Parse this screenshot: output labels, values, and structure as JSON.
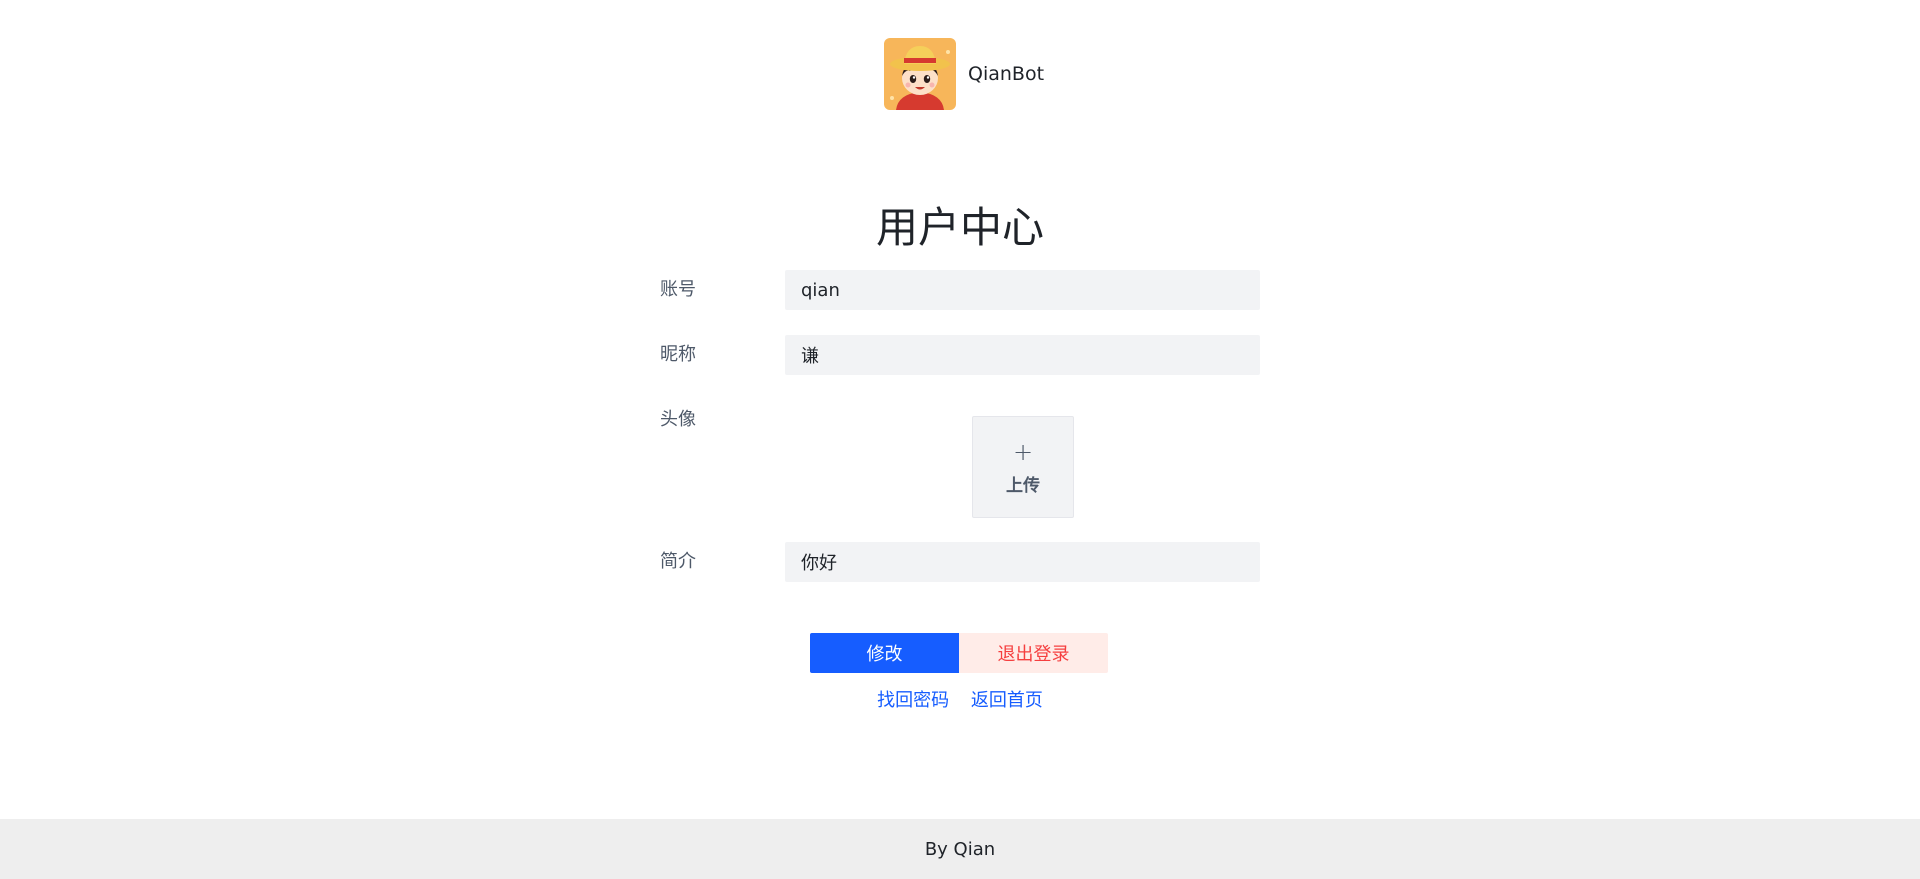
{
  "header": {
    "brand_name": "QianBot",
    "avatar_icon": "cartoon-boy-straw-hat-avatar"
  },
  "page": {
    "title": "用户中心"
  },
  "form": {
    "account": {
      "label": "账号",
      "value": "qian"
    },
    "nickname": {
      "label": "昵称",
      "value": "谦"
    },
    "avatar": {
      "label": "头像",
      "upload_icon": "plus-icon",
      "upload_label": "上传"
    },
    "bio": {
      "label": "简介",
      "value": "你好"
    }
  },
  "actions": {
    "save_label": "修改",
    "logout_label": "退出登录"
  },
  "links": {
    "forgot_password": "找回密码",
    "back_home": "返回首页"
  },
  "footer": {
    "text": "By Qian"
  },
  "colors": {
    "primary": "#165dff",
    "danger": "#f53f3f",
    "danger_bg": "#ffece8",
    "input_bg": "#f2f3f5",
    "footer_bg": "#eeeeee"
  }
}
